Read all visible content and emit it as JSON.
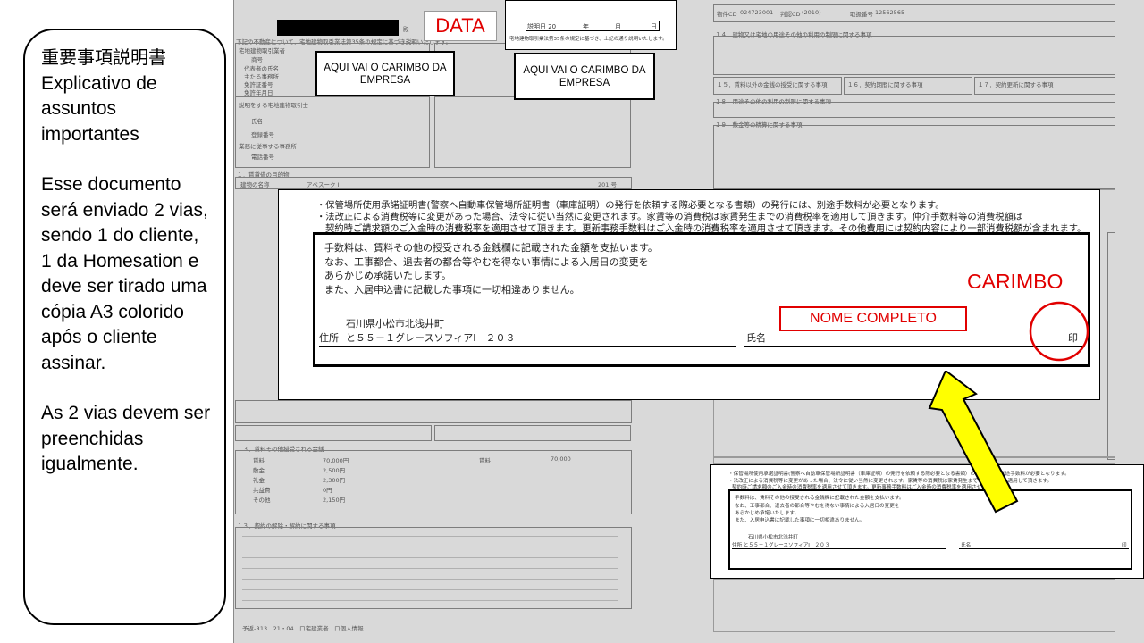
{
  "instructions": {
    "title_jp": "重要事項説明書",
    "title_pt": "Explicativo de assuntos importantes",
    "paragraph1": "Esse documento será enviado 2 vias, sendo 1 do cliente, 1 da Homesation e deve ser tirado uma cópia A3 colorido após o cliente assinar.",
    "paragraph2": "As 2 vias devem ser preenchidas igualmente."
  },
  "annotations": {
    "data_label": "DATA",
    "stamp_company_1": "AQUI VAI O CARIMBO DA EMPRESA",
    "stamp_company_2": "AQUI VAI O CARIMBO DA EMPRESA",
    "carimbo": "CARIMBO",
    "nome_completo": "NOME COMPLETO"
  },
  "date_box": {
    "label": "説明日 20",
    "year": "年",
    "month": "月",
    "day": "日",
    "note": "宅地建物取引業法第35条の規定に基づき、上記の通り説明いたします。"
  },
  "zoom": {
    "line1": "・保管場所使用承諾証明書(警察へ自動車保管場所証明書（車庫証明）の発行を依頼する際必要となる書類）の発行には、別途手数料が必要となります。",
    "line2": "・法改正による消費税等に変更があった場合、法令に従い当然に変更されます。家賃等の消費税は家賃発生までの消費税率を適用して頂きます。仲介手数料等の消費税額は",
    "line3": "契約時ご請求額のご入金時の消費税率を適用させて頂きます。更新事務手数料はご入金時の消費税率を適用させて頂きます。その他費用には契約内容により一部消費税額が含まれます。",
    "inner1": "手数料は、賃料その他の授受される金銭欄に記載された金額を支払います。",
    "inner2": "なお、工事都合、退去者の都合等やむを得ない事情による入居日の変更を",
    "inner3": "あらかじめ承諾いたします。",
    "inner4": "また、入居申込書に記載した事項に一切相違ありません。",
    "address1": "石川県小松市北浅井町",
    "address_label": "住所",
    "address2": "と５５－１グレースソフィアⅠ　２０３",
    "name_label": "氏名",
    "seal": "印"
  },
  "small_zoom": {
    "line1": "・保管場所使用承諾証明書(警察へ自動車保管場所証明書（車庫証明）の発行を依頼する際必要となる書類）の発行には、別途手数料が必要となります。",
    "line2": "・法改正による消費税等に変更があった場合、法令に従い当然に変更されます。家賃等の消費税は家賃発生までの消費税率を適用して頂きます。",
    "line3": "契約時ご請求額のご入金時の消費税率を適用させて頂きます。更新事務手数料はご入金時の消費税率を適用させて頂きます。",
    "inner1": "手数料は、賃料その他の授受される金銭欄に記載された金額を支払います。",
    "inner2": "なお、工事都合、退去者の都合等やむを得ない事情による入居日の変更を",
    "inner3": "あらかじめ承諾いたします。",
    "inner4": "また、入居申込書に記載した事項に一切相違ありません。",
    "address1": "石川県小松市北浅井町",
    "address2": "住所 と５５－１グレースソフィアⅠ　２０３",
    "name_label": "氏名",
    "seal": "印"
  },
  "doc_bg": {
    "top_left": "殿",
    "header_note": "下記の不動産について、宅地建物取引業法第35条の規定に基づき説明いたします。",
    "table_a": [
      "宅地建物取引業者",
      "商号",
      "代表者の氏名",
      "主たる事務所",
      "免許証番号",
      "免許年月日"
    ],
    "table_b": [
      "説明をする宅地建物取引士",
      "氏名",
      "登録番号",
      "業務に従事する事務所",
      "電話番号"
    ],
    "section1": "１．賃貸借の目的物",
    "prop_name": "建物の名称",
    "prop_value": "アベスーク Ⅰ",
    "prop_room": "201 号",
    "rent_label": "賃料",
    "rent_value": "70,000",
    "right_header": [
      "物件CD",
      "024723001",
      "判認CD",
      "(2010)",
      "取扱番号",
      "12562565"
    ],
    "section_r1": "１４．建物又は宅地の用途その他の利用の制限に関する事項",
    "section_r2": "１５．賃料以外の金銭の授受に関する事項",
    "section_r3": "１６．契約期間に関する事項",
    "section_r4": "１７．契約更新に関する事項",
    "section_r5": "１８．用途その他の利用の制限に関する事項",
    "section_r6": "１９．敷金等の精算に関する事項",
    "fees_header": "１３．賃料その他授受される金銭",
    "fee_rows": [
      "賃料",
      "敷金",
      "礼金",
      "共益費",
      "その他"
    ],
    "fee_values": [
      "70,000円",
      "2,500円",
      "2,300円",
      "0円",
      "2,150円"
    ],
    "cancel_header": "１３．契約の解除・解約に関する事項",
    "footer": "予返-R13　21・04　口宅建業者　口個人情報"
  }
}
